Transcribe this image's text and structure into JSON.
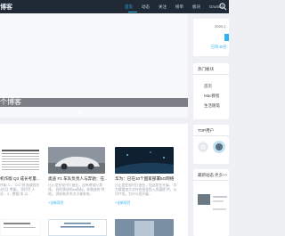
{
  "header": {
    "logo_text": "博客",
    "nav": [
      "首页",
      "动态",
      "关注",
      "榜单",
      "板块",
      "Grumbli"
    ],
    "active_index": 0
  },
  "banner": {
    "caption": "个博客"
  },
  "user_panel": {
    "date": "2020-1",
    "status": "已有40名"
  },
  "hot_sections": {
    "title": "热门板块",
    "items": [
      "首页",
      "Mac教程",
      "生活随笔"
    ]
  },
  "top_users": {
    "title": "TOP用户"
  },
  "latest": {
    "title": "最新动态",
    "more": "更多>>"
  },
  "feed": {
    "title": "",
    "articles": [
      {
        "title": "机作版 Q3 成长考量...",
        "summary": "作版 3 。  CIC 排 报道程关 3亿日 考量。 项目目 人员... 2，数据 发 以...",
        "category": ""
      },
      {
        "title": "奥迪 F1 车队负责人与奔驰：在...",
        "summary": "日正是在现代打造业，没有地狱打游 戏。 同时奥迪的aa指标，奔驰造的 特地。 资料有关车大小量发电...",
        "category": "+全新项目"
      },
      {
        "title": "华为：已在10个国家部署5G网络",
        "summary": "日正是在现代打造业，您这是在开展， 华为需要加大对外的资金投入发展提 供，公司介绍。为什么您开展...",
        "category": "+全新项目"
      }
    ]
  },
  "colors": {
    "accent": "#2fb2ee",
    "topbar": "#1f2a36",
    "page_bg": "#eef0f3"
  }
}
